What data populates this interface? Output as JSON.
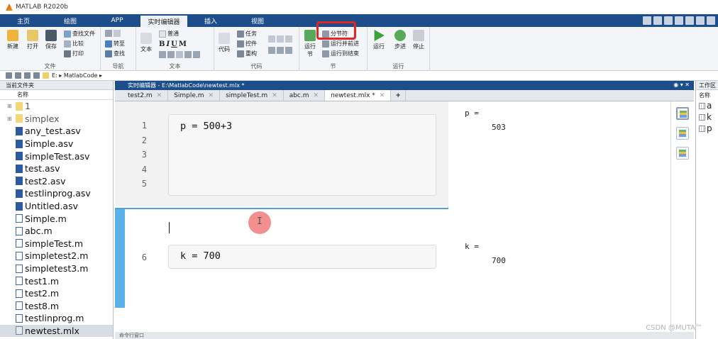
{
  "window": {
    "title": "MATLAB R2020b"
  },
  "tabs": [
    {
      "label": "主页",
      "active": false
    },
    {
      "label": "绘图",
      "active": false
    },
    {
      "label": "APP",
      "active": false
    },
    {
      "label": "实时编辑器",
      "active": true
    },
    {
      "label": "插入",
      "active": false
    },
    {
      "label": "视图",
      "active": false
    }
  ],
  "ribbon": {
    "file": {
      "label": "文件",
      "new": "新建",
      "open": "打开",
      "save": "保存",
      "find_files": "查找文件",
      "compare": "比较",
      "print": "打印"
    },
    "nav": {
      "label": "导航",
      "goto": "转至",
      "find": "查找"
    },
    "text": {
      "label": "文本",
      "text_btn": "文本",
      "style": "普通",
      "bold": "B",
      "italic": "I",
      "underline": "U",
      "mono": "M"
    },
    "code": {
      "label": "代码",
      "code_btn": "代码",
      "task": "任务",
      "control": "控件",
      "refactor": "重构"
    },
    "section": {
      "label": "节",
      "run_section": "运行节",
      "section_break": "分节符",
      "run_and_advance": "运行并前进",
      "run_to_end": "运行到结束"
    },
    "run": {
      "label": "运行",
      "run": "运行",
      "step": "步进",
      "stop": "停止"
    }
  },
  "address": {
    "path": "E: ▸ MatlabCode ▸"
  },
  "current_folder": {
    "title": "当前文件夹",
    "column": "名称",
    "items": [
      {
        "name": "1",
        "type": "folder"
      },
      {
        "name": "simplex",
        "type": "folder"
      },
      {
        "name": "any_test.asv",
        "type": "file"
      },
      {
        "name": "Simple.asv",
        "type": "file"
      },
      {
        "name": "simpleTest.asv",
        "type": "file"
      },
      {
        "name": "test.asv",
        "type": "file"
      },
      {
        "name": "test2.asv",
        "type": "file"
      },
      {
        "name": "testlinprog.asv",
        "type": "file"
      },
      {
        "name": "Untitled.asv",
        "type": "file"
      },
      {
        "name": "Simple.m",
        "type": "m"
      },
      {
        "name": "abc.m",
        "type": "m"
      },
      {
        "name": "simpleTest.m",
        "type": "m"
      },
      {
        "name": "simpletest2.m",
        "type": "m"
      },
      {
        "name": "simpletest3.m",
        "type": "m"
      },
      {
        "name": "test1.m",
        "type": "m"
      },
      {
        "name": "test2.m",
        "type": "m"
      },
      {
        "name": "test8.m",
        "type": "m"
      },
      {
        "name": "testlinprog.m",
        "type": "m"
      },
      {
        "name": "newtest.mlx",
        "type": "mlx",
        "selected": true
      }
    ]
  },
  "editor": {
    "title": "实时编辑器 - E:\\MatlabCode\\newtest.mlx *",
    "tabs": [
      {
        "label": "test2.m",
        "active": false
      },
      {
        "label": "Simple.m",
        "active": false
      },
      {
        "label": "simpleTest.m",
        "active": false
      },
      {
        "label": "abc.m",
        "active": false
      },
      {
        "label": "newtest.mlx *",
        "active": true
      }
    ],
    "section1": {
      "line_numbers": [
        "1",
        "2",
        "3",
        "4",
        "5"
      ],
      "code": "p = 500+3"
    },
    "section2": {
      "line_number": "6",
      "code": "k = 700"
    },
    "outputs": [
      {
        "var": "p =",
        "value": "503"
      },
      {
        "var": "k =",
        "value": "700"
      }
    ]
  },
  "workspace": {
    "title": "工作区",
    "column": "名称",
    "vars": [
      "a",
      "k",
      "p"
    ]
  },
  "command_window": {
    "title": "命令行窗口"
  },
  "watermark": "CSDN @MUTA™"
}
